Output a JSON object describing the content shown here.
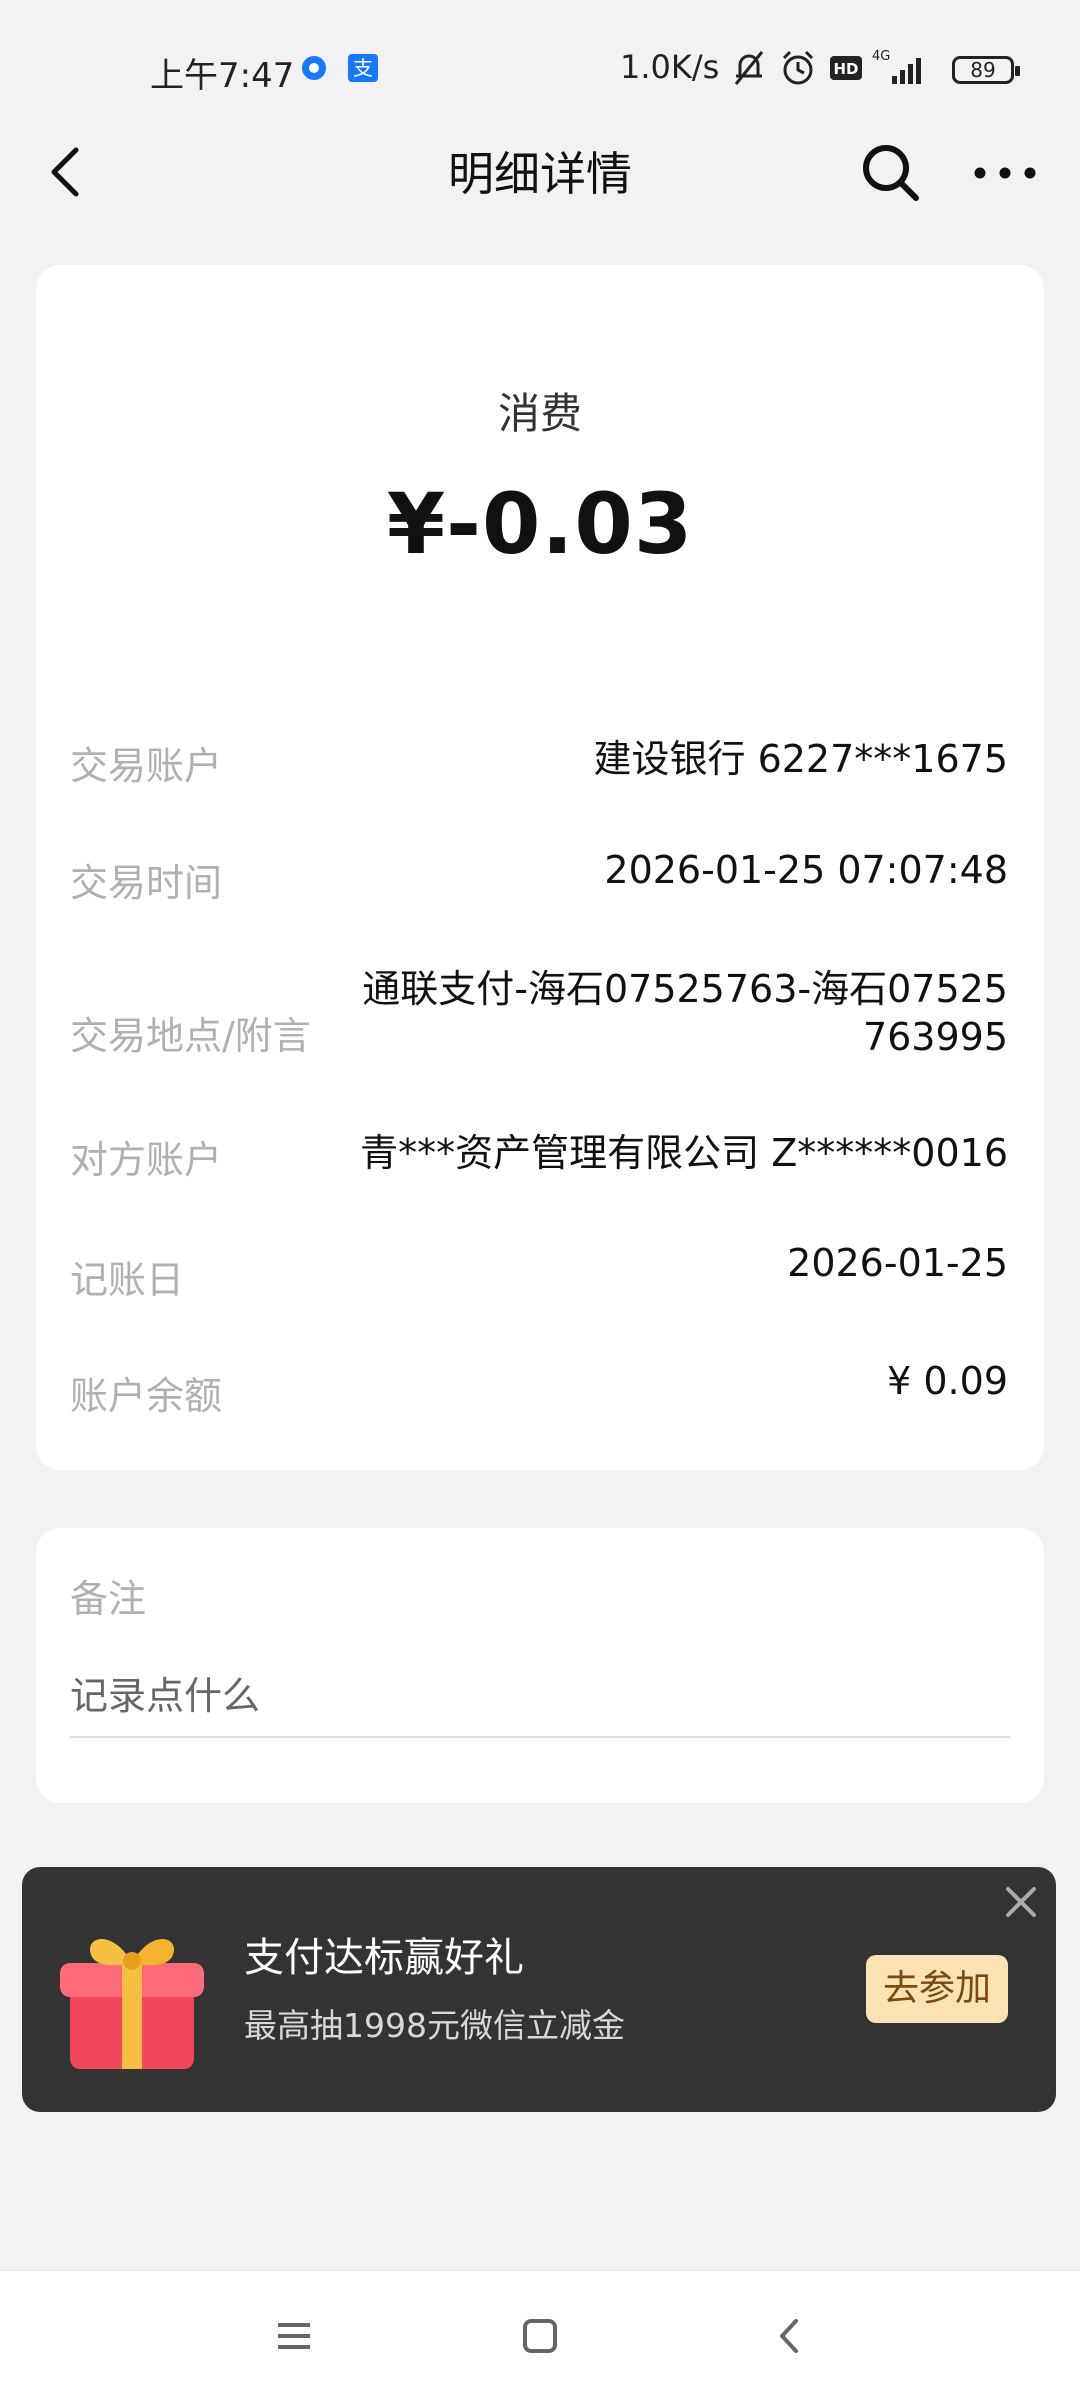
{
  "status_bar": {
    "time": "上午7:47",
    "app_icon_2": "支",
    "net_speed": "1.0K/s",
    "network": "4G",
    "battery": "89",
    "icons": [
      "blue-circle-app-icon",
      "alipay-icon",
      "mute-bell-icon",
      "alarm-icon",
      "hd-icon",
      "signal-icon",
      "battery-icon"
    ]
  },
  "header": {
    "title": "明细详情",
    "icons": [
      "back-arrow-icon",
      "search-icon",
      "more-icon"
    ]
  },
  "transaction": {
    "type": "消费",
    "amount": "¥-0.03",
    "rows": [
      {
        "label": "交易账户",
        "value": "建设银行 6227***1675"
      },
      {
        "label": "交易时间",
        "value": "2026-01-25 07:07:48"
      },
      {
        "label": "交易地点/附言",
        "value_line1": "通联支付-海石07525763-海石07525",
        "value_line2": "763995"
      },
      {
        "label": "对方账户",
        "value": "青***资产管理有限公司 Z******0016"
      },
      {
        "label": "记账日",
        "value": "2026-01-25"
      },
      {
        "label": "账户余额",
        "value": "¥ 0.09"
      }
    ]
  },
  "note": {
    "title": "备注",
    "placeholder": "记录点什么"
  },
  "promo": {
    "title": "支付达标赢好礼",
    "subtitle": "最高抽1998元微信立减金",
    "button": "去参加"
  },
  "colors": {
    "page_bg": "#f2f2f4",
    "card_bg": "#ffffff",
    "promo_bg": "#333333",
    "promo_button": "#fbe2b3",
    "label_gray": "#b0b0b0"
  }
}
